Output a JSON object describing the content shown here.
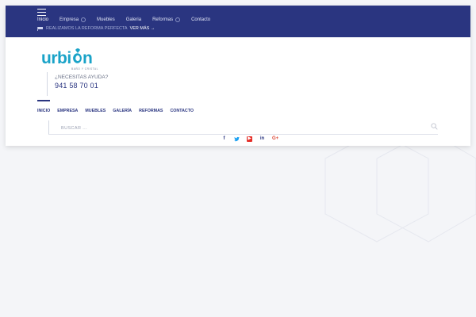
{
  "topbar": {
    "nav": [
      {
        "label": "Inicio",
        "has_submenu": false
      },
      {
        "label": "Empresa",
        "has_submenu": true
      },
      {
        "label": "Muebles",
        "has_submenu": false
      },
      {
        "label": "Galeria",
        "has_submenu": false
      },
      {
        "label": "Reformas",
        "has_submenu": true
      },
      {
        "label": "Contacto",
        "has_submenu": false
      }
    ],
    "promo_text": "REALIZAMOS LA REFORMA PERFECTA",
    "promo_link": "VER MÁS →"
  },
  "logo": {
    "text": "urbion",
    "tagline": "BAÑO Y CRISTAL"
  },
  "help": {
    "label": "¿NECESITAS AYUDA?",
    "phone": "941 58 70 01"
  },
  "main_nav": [
    "INICIO",
    "EMPRESA",
    "MUEBLES",
    "GALERÍA",
    "REFORMAS",
    "CONTACTO"
  ],
  "search": {
    "placeholder": "BUSCAR ..."
  },
  "social": [
    "facebook-icon",
    "twitter-icon",
    "youtube-icon",
    "linkedin-icon",
    "google-plus-icon"
  ],
  "colors": {
    "brand": "#2a3580",
    "logo_teal": "#1aa3c8",
    "background": "#f4f5f8"
  }
}
